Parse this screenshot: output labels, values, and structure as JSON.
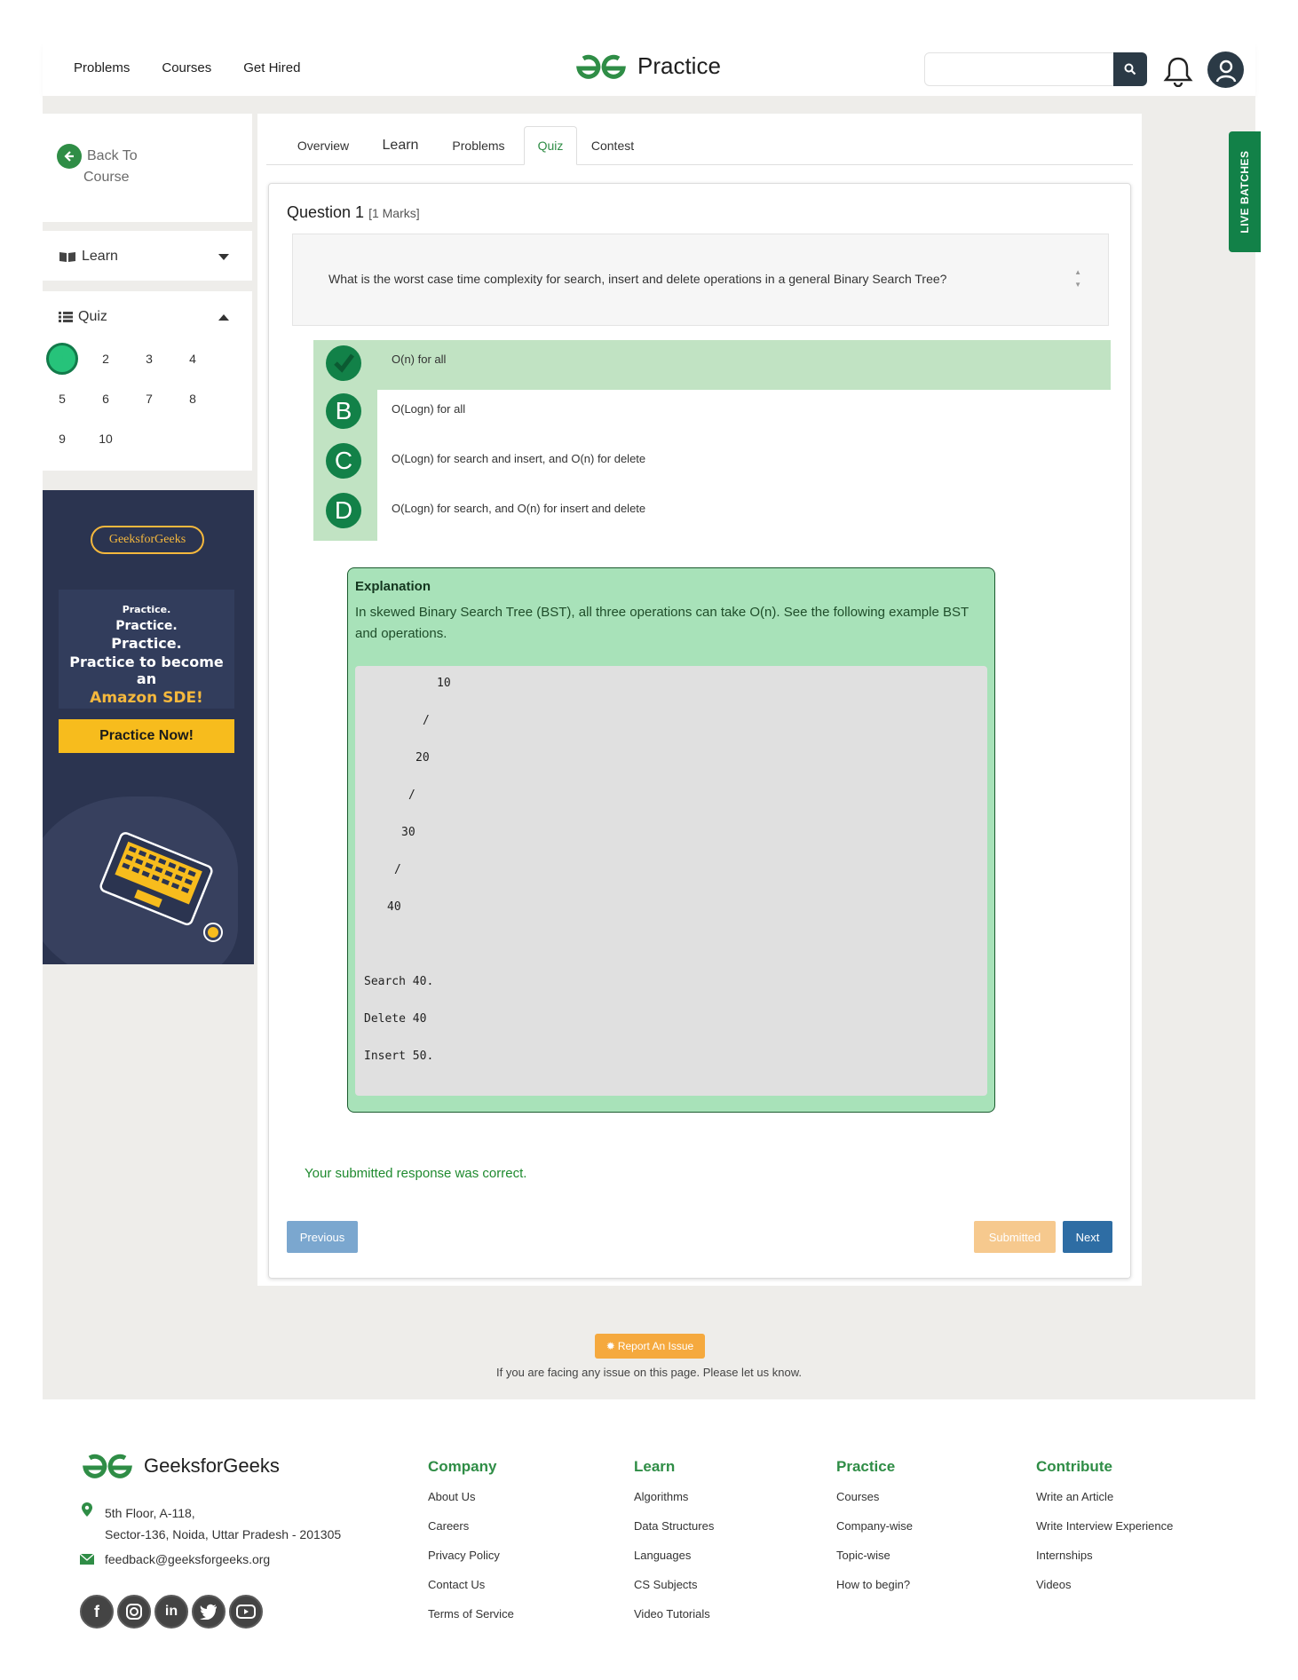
{
  "nav": {
    "problems": "Problems",
    "courses": "Courses",
    "get_hired": "Get Hired",
    "brand": "Practice",
    "search_placeholder": ""
  },
  "sidebar": {
    "back_line1": "Back To",
    "back_line2": "Course",
    "learn_label": "Learn",
    "quiz_label": "Quiz",
    "question_numbers": [
      "1",
      "2",
      "3",
      "4",
      "5",
      "6",
      "7",
      "8",
      "9",
      "10"
    ],
    "active_question": "1"
  },
  "ad": {
    "logo": "GeeksforGeeks",
    "line1": "Practice.",
    "line2": "Practice.",
    "line3": "Practice.",
    "line4": "Practice to become an",
    "line5": "Amazon SDE!",
    "button": "Practice Now!"
  },
  "tabs": [
    "Overview",
    "Learn",
    "Problems",
    "Quiz",
    "Contest"
  ],
  "active_tab": "Quiz",
  "question": {
    "title": "Question 1",
    "marks": "[1 Marks]",
    "text": "What is the worst case time complexity for search, insert and delete operations in a general Binary Search Tree?"
  },
  "options": [
    {
      "letter": "✔",
      "text": "O(n) for all",
      "selected": true
    },
    {
      "letter": "B",
      "text": "O(Logn) for all",
      "selected": false
    },
    {
      "letter": "C",
      "text": "O(Logn) for search and insert, and O(n) for delete",
      "selected": false
    },
    {
      "letter": "D",
      "text": "O(Logn) for search, and O(n) for insert and delete",
      "selected": false
    }
  ],
  "explanation": {
    "title": "Explanation",
    "text": "In skewed Binary Search Tree (BST), all three operations can take O(n). See the following example BST and operations.",
    "code": [
      "10",
      "/",
      "20",
      "/",
      "30",
      "/",
      "40",
      "Search 40.",
      "Delete 40",
      "Insert 50."
    ]
  },
  "result_message": "Your submitted response was correct.",
  "buttons": {
    "previous": "Previous",
    "submitted": "Submitted",
    "next": "Next"
  },
  "live_batches": "LIVE BATCHES",
  "report": {
    "button": "Report An Issue",
    "text": "If you are facing any issue on this page. Please let us know."
  },
  "footer": {
    "brand": "GeeksforGeeks",
    "address_line1": "5th Floor, A-118,",
    "address_line2": "Sector-136, Noida, Uttar Pradesh - 201305",
    "email": "feedback@geeksforgeeks.org",
    "columns": [
      {
        "title": "Company",
        "links": [
          "About Us",
          "Careers",
          "Privacy Policy",
          "Contact Us",
          "Terms of Service"
        ]
      },
      {
        "title": "Learn",
        "links": [
          "Algorithms",
          "Data Structures",
          "Languages",
          "CS Subjects",
          "Video Tutorials"
        ]
      },
      {
        "title": "Practice",
        "links": [
          "Courses",
          "Company-wise",
          "Topic-wise",
          "How to begin?"
        ]
      },
      {
        "title": "Contribute",
        "links": [
          "Write an Article",
          "Write Interview Experience",
          "Internships",
          "Videos"
        ]
      }
    ],
    "socials": [
      "facebook-icon",
      "instagram-icon",
      "linkedin-icon",
      "twitter-icon",
      "youtube-icon"
    ]
  },
  "colors": {
    "brand_green": "#2f8d46",
    "option_green": "#128148",
    "selected_bg": "#c1e3c3",
    "explanation_bg": "#a8e2b9",
    "next_blue": "#2e6da4",
    "previous_blue": "#7ba7cf",
    "submitted_orange": "#f6c98e"
  }
}
